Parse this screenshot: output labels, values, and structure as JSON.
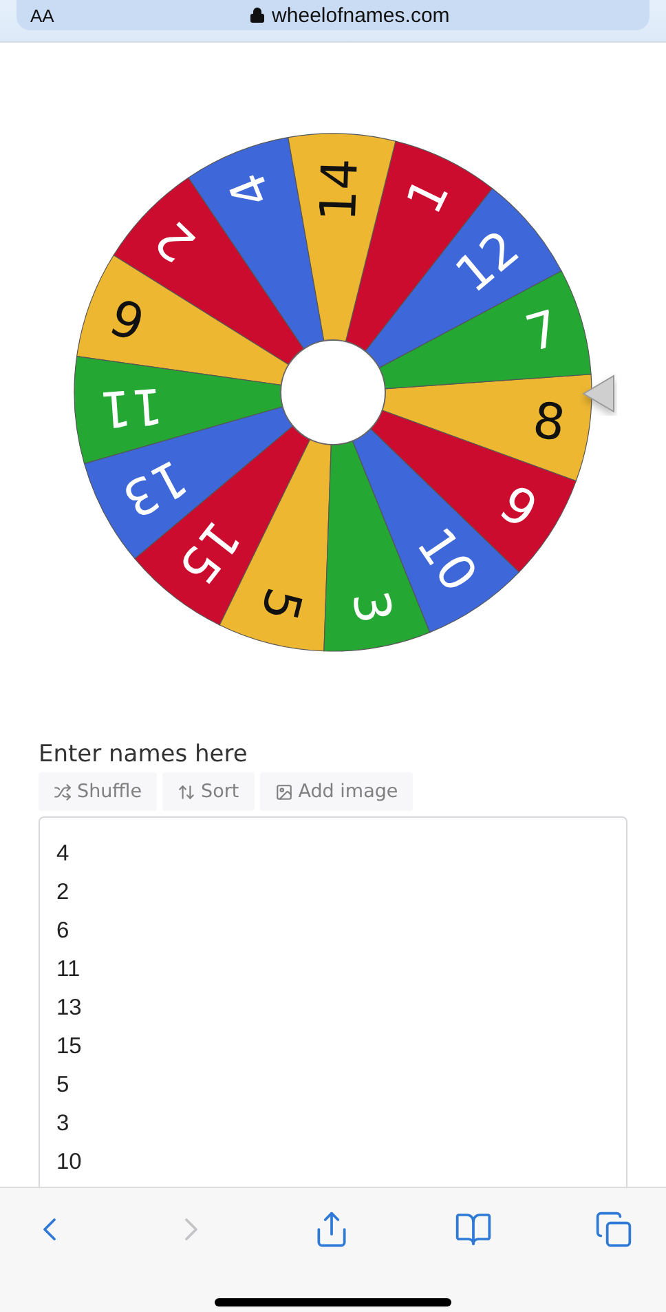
{
  "address_bar": {
    "text_size_button": "AA",
    "url": "wheelofnames.com"
  },
  "wheel": {
    "segments": [
      {
        "label": "4",
        "color": "#3e68d9"
      },
      {
        "label": "2",
        "color": "#cc0c2f"
      },
      {
        "label": "6",
        "color": "#eeb732"
      },
      {
        "label": "11",
        "color": "#24a733"
      },
      {
        "label": "13",
        "color": "#3e68d9"
      },
      {
        "label": "15",
        "color": "#cc0c2f"
      },
      {
        "label": "5",
        "color": "#eeb732"
      },
      {
        "label": "3",
        "color": "#24a733"
      },
      {
        "label": "10",
        "color": "#3e68d9"
      },
      {
        "label": "9",
        "color": "#cc0c2f"
      },
      {
        "label": "8",
        "color": "#eeb732"
      },
      {
        "label": "7",
        "color": "#24a733"
      },
      {
        "label": "12",
        "color": "#3e68d9"
      },
      {
        "label": "1",
        "color": "#cc0c2f"
      },
      {
        "label": "14",
        "color": "#eeb732"
      }
    ]
  },
  "editor": {
    "label": "Enter names here",
    "tools": [
      {
        "kind": "shuffle",
        "label": "Shuffle"
      },
      {
        "kind": "sort",
        "label": "Sort"
      },
      {
        "kind": "image",
        "label": "Add image"
      }
    ],
    "entries": [
      "4",
      "2",
      "6",
      "11",
      "13",
      "15",
      "5",
      "3",
      "10"
    ]
  },
  "toolbar": [
    {
      "kind": "back",
      "disabled": false
    },
    {
      "kind": "forward",
      "disabled": true
    },
    {
      "kind": "share",
      "disabled": false
    },
    {
      "kind": "bookmarks",
      "disabled": false
    },
    {
      "kind": "tabs",
      "disabled": false
    }
  ]
}
